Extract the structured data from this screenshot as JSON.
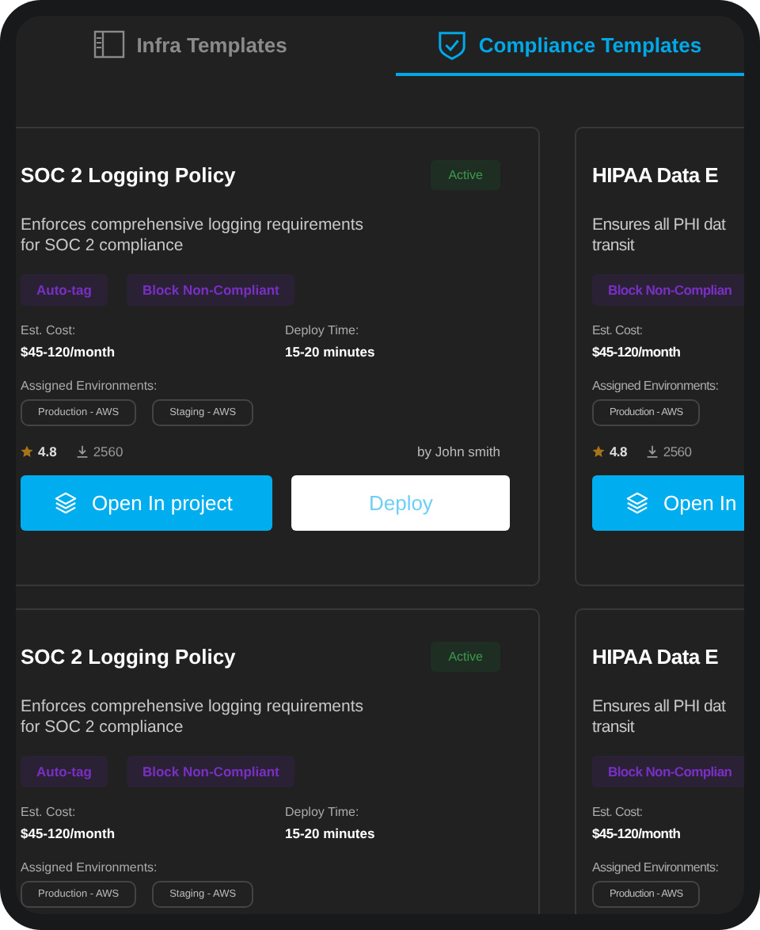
{
  "tabs": [
    {
      "label": "Infra Templates",
      "selected": false
    },
    {
      "label": "Compliance Templates",
      "selected": true
    }
  ],
  "card_rows": [
    {
      "cards": [
        {
          "title": "SOC 2 Logging Policy",
          "status": "Active",
          "description": [
            "Enforces comprehensive logging requirements",
            "for SOC 2 compliance"
          ],
          "tags": [
            "Auto-tag",
            "Block Non-Compliant"
          ],
          "stats": [
            {
              "label": "Est. Cost:",
              "value": "$45-120/month"
            },
            {
              "label": "Deploy Time:",
              "value": "15-20 minutes"
            }
          ],
          "environments_label": "Assigned Environments:",
          "environments": [
            "Production - AWS",
            "Staging - AWS"
          ],
          "rating": "4.8",
          "downloads": "2560",
          "author": "by John smith",
          "buttons": [
            {
              "label": "Open In project",
              "kind": "primary"
            },
            {
              "label": "Deploy",
              "kind": "secondary"
            }
          ]
        },
        {
          "title": "HIPAA Data E",
          "description": [
            "Ensures all PHI dat",
            "transit"
          ],
          "tags": [
            "Block Non-Complian"
          ],
          "stats": [
            {
              "label": "Est. Cost:",
              "value": "$45-120/month"
            }
          ],
          "environments_label": "Assigned Environments:",
          "environments": [
            "Production - AWS"
          ],
          "rating": "4.8",
          "downloads": "2560",
          "buttons": [
            {
              "label": "Open In",
              "kind": "primary"
            }
          ]
        }
      ]
    },
    {
      "cards": [
        {
          "title": "SOC 2 Logging Policy",
          "status": "Active",
          "description": [
            "Enforces comprehensive logging requirements",
            "for SOC 2 compliance"
          ],
          "tags": [
            "Auto-tag",
            "Block Non-Compliant"
          ],
          "stats": [
            {
              "label": "Est. Cost:",
              "value": "$45-120/month"
            },
            {
              "label": "Deploy Time:",
              "value": "15-20 minutes"
            }
          ],
          "environments_label": "Assigned Environments:",
          "environments": [
            "Production - AWS",
            "Staging - AWS"
          ]
        },
        {
          "title": "HIPAA Data E",
          "description": [
            "Ensures all PHI dat",
            "transit"
          ],
          "tags": [
            "Block Non-Complian"
          ],
          "stats": [
            {
              "label": "Est. Cost:",
              "value": "$45-120/month"
            }
          ],
          "environments_label": "Assigned Environments:",
          "environments": [
            "Production - AWS"
          ]
        }
      ]
    }
  ]
}
